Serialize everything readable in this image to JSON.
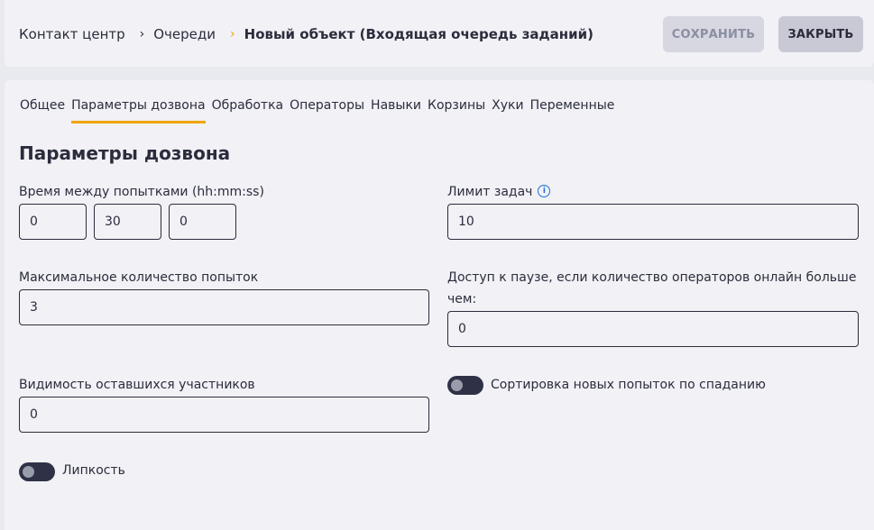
{
  "breadcrumbs": {
    "item1": "Контакт центр",
    "item2": "Очереди",
    "current": "Новый объект (Входящая очередь заданий)",
    "sep": "›"
  },
  "toolbar": {
    "save_label": "СОХРАНИТЬ",
    "close_label": "ЗАКРЫТЬ"
  },
  "tabs": [
    {
      "label": "Общее",
      "active": false
    },
    {
      "label": "Параметры дозвона",
      "active": true
    },
    {
      "label": "Обработка",
      "active": false
    },
    {
      "label": "Операторы",
      "active": false
    },
    {
      "label": "Навыки",
      "active": false
    },
    {
      "label": "Корзины",
      "active": false
    },
    {
      "label": "Хуки",
      "active": false
    },
    {
      "label": "Переменные",
      "active": false
    }
  ],
  "section": {
    "title": "Параметры дозвона"
  },
  "fields": {
    "retry_interval": {
      "label": "Время между попытками (hh:mm:ss)",
      "hours": "0",
      "minutes": "30",
      "seconds": "0"
    },
    "task_limit": {
      "label": "Лимит задач",
      "value": "10",
      "info_icon": "info-icon"
    },
    "max_attempts": {
      "label": "Максимальное количество попыток",
      "value": "3"
    },
    "pause_access": {
      "label": "Доступ к паузе, если количество операторов онлайн больше чем:",
      "value": "0"
    },
    "remaining_visibility": {
      "label": "Видимость оставшихся участников",
      "value": "0"
    },
    "sort_desc": {
      "label": "Сортировка новых попыток по спаданию",
      "enabled": false
    },
    "stickiness": {
      "label": "Липкость",
      "enabled": false
    }
  },
  "colors": {
    "accent": "#f0a500",
    "info": "#1d6fd8",
    "text": "#2b2d3c"
  }
}
